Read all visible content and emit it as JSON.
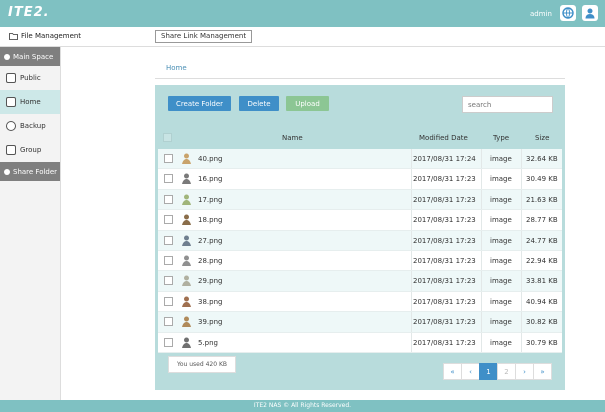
{
  "header": {
    "logo": "ITE2.",
    "user": "admin",
    "colors": {
      "bar": "#7fc1c2",
      "accent": "#3f8fc8",
      "upload": "#8cc694"
    }
  },
  "menu": {
    "file_management": "File Management",
    "share_link_management": "Share Link Management"
  },
  "sidebar": {
    "main_space": "Main Space",
    "items": [
      {
        "label": "Public",
        "icon": "public-icon"
      },
      {
        "label": "Home",
        "icon": "home-icon"
      },
      {
        "label": "Backup",
        "icon": "backup-icon"
      },
      {
        "label": "Group",
        "icon": "group-icon"
      }
    ],
    "share_folder": "Share Folder"
  },
  "breadcrumb": "Home",
  "toolbar": {
    "create_folder": "Create Folder",
    "delete": "Delete",
    "upload": "Upload",
    "search_placeholder": "search"
  },
  "table": {
    "columns": [
      "Name",
      "Modified Date",
      "Type",
      "Size"
    ],
    "rows": [
      {
        "name": "40.png",
        "date": "2017/08/31 17:24",
        "type": "image",
        "size": "32.64 KB"
      },
      {
        "name": "16.png",
        "date": "2017/08/31 17:23",
        "type": "image",
        "size": "30.49 KB"
      },
      {
        "name": "17.png",
        "date": "2017/08/31 17:23",
        "type": "image",
        "size": "21.63 KB"
      },
      {
        "name": "18.png",
        "date": "2017/08/31 17:23",
        "type": "image",
        "size": "28.77 KB"
      },
      {
        "name": "27.png",
        "date": "2017/08/31 17:23",
        "type": "image",
        "size": "24.77 KB"
      },
      {
        "name": "28.png",
        "date": "2017/08/31 17:23",
        "type": "image",
        "size": "22.94 KB"
      },
      {
        "name": "29.png",
        "date": "2017/08/31 17:23",
        "type": "image",
        "size": "33.81 KB"
      },
      {
        "name": "38.png",
        "date": "2017/08/31 17:23",
        "type": "image",
        "size": "40.94 KB"
      },
      {
        "name": "39.png",
        "date": "2017/08/31 17:23",
        "type": "image",
        "size": "30.82 KB"
      },
      {
        "name": "5.png",
        "date": "2017/08/31 17:23",
        "type": "image",
        "size": "30.79 KB"
      }
    ]
  },
  "usage": "You used 420 KB",
  "pagination": {
    "first": "«",
    "prev": "‹",
    "pages": [
      "1",
      "2"
    ],
    "current": "1",
    "next": "›",
    "last": "»"
  },
  "footer": "ITE2 NAS © All Rights Reserved."
}
